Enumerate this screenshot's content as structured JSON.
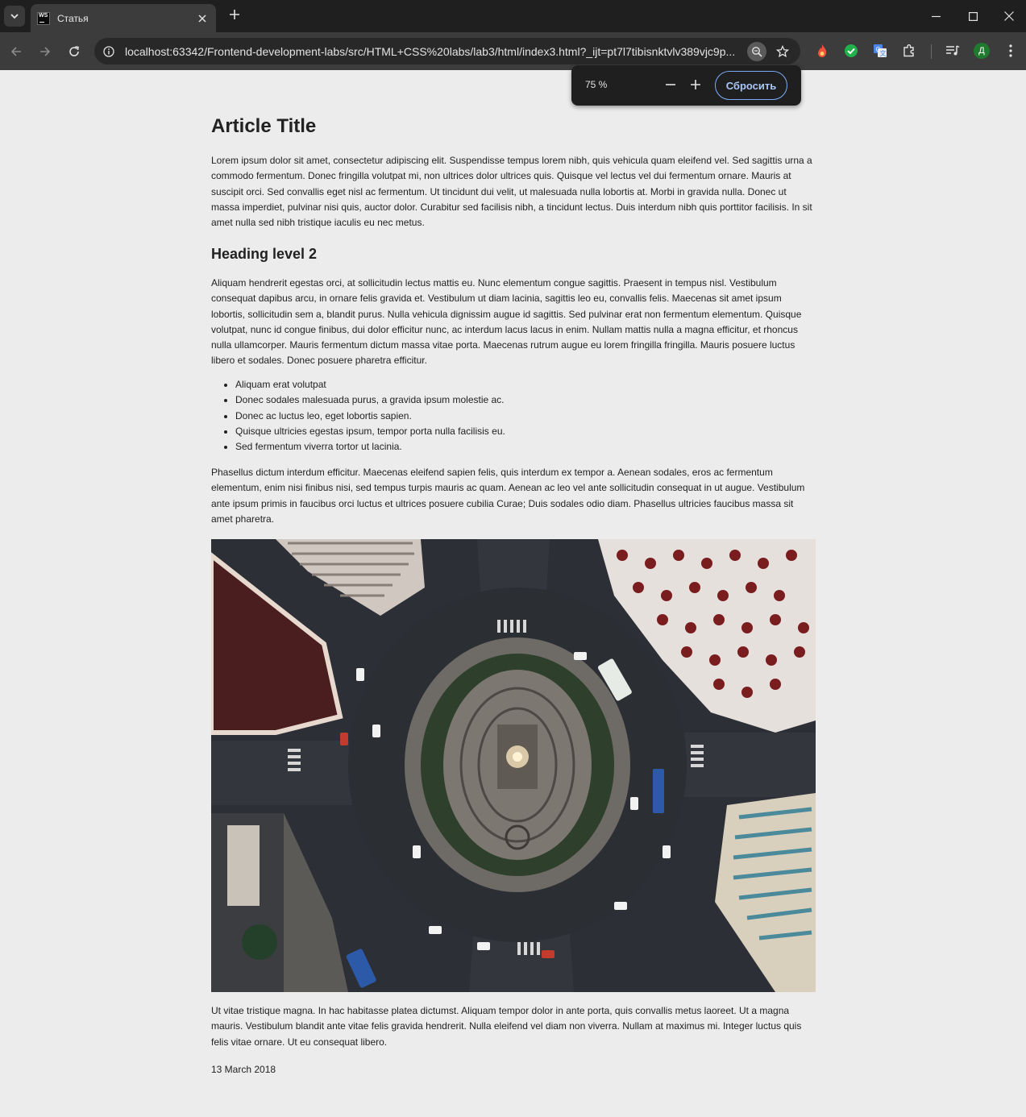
{
  "browser": {
    "tab_title": "Статья",
    "favicon_text": "WS",
    "url": "localhost:63342/Frontend-development-labs/src/HTML+CSS%20labs/lab3/html/index3.html?_ijt=pt7l7tibisnktvlv389vjc9p...",
    "avatar_letter": "Д"
  },
  "zoom_popup": {
    "level": "75 %",
    "minus": "−",
    "plus": "+",
    "reset_label": "Сбросить"
  },
  "article": {
    "title": "Article Title",
    "intro": "Lorem ipsum dolor sit amet, consectetur adipiscing elit. Suspendisse tempus lorem nibh, quis vehicula quam eleifend vel. Sed sagittis urna a commodo fermentum. Donec fringilla volutpat mi, non ultrices dolor ultrices quis. Quisque vel lectus vel dui fermentum ornare. Mauris at suscipit orci. Sed convallis eget nisl ac fermentum. Ut tincidunt dui velit, ut malesuada nulla lobortis at. Morbi in gravida nulla. Donec ut massa imperdiet, pulvinar nisi quis, auctor dolor. Curabitur sed facilisis nibh, a tincidunt lectus. Duis interdum nibh quis porttitor facilisis. In sit amet nulla sed nibh tristique iaculis eu nec metus.",
    "heading2": "Heading level 2",
    "paragraph2": "Aliquam hendrerit egestas orci, at sollicitudin lectus mattis eu. Nunc elementum congue sagittis. Praesent in tempus nisl. Vestibulum consequat dapibus arcu, in ornare felis gravida et. Vestibulum ut diam lacinia, sagittis leo eu, convallis felis. Maecenas sit amet ipsum lobortis, sollicitudin sem a, blandit purus. Nulla vehicula dignissim augue id sagittis. Sed pulvinar erat non fermentum elementum. Quisque volutpat, nunc id congue finibus, dui dolor efficitur nunc, ac interdum lacus lacus in enim. Nullam mattis nulla a magna efficitur, et rhoncus nulla ullamcorper. Mauris fermentum dictum massa vitae porta. Maecenas rutrum augue eu lorem fringilla fringilla. Mauris posuere luctus libero et sodales. Donec posuere pharetra efficitur.",
    "list": [
      "Aliquam erat volutpat",
      "Donec sodales malesuada purus, a gravida ipsum molestie ac.",
      "Donec ac luctus leo, eget lobortis sapien.",
      "Quisque ultricies egestas ipsum, tempor porta nulla facilisis eu.",
      "Sed fermentum viverra tortor ut lacinia."
    ],
    "paragraph3": "Phasellus dictum interdum efficitur. Maecenas eleifend sapien felis, quis interdum ex tempor a. Aenean sodales, eros ac fermentum elementum, enim nisi finibus nisi, sed tempus turpis mauris ac quam. Aenean ac leo vel ante sollicitudin consequat in ut augue. Vestibulum ante ipsum primis in faucibus orci luctus et ultrices posuere cubilia Curae; Duis sodales odio diam. Phasellus ultricies faucibus massa sit amet pharetra.",
    "paragraph4": "Ut vitae tristique magna. In hac habitasse platea dictumst. Aliquam tempor dolor in ante porta, quis convallis metus laoreet. Ut a magna mauris. Vestibulum blandit ante vitae felis gravida hendrerit. Nulla eleifend vel diam non viverra. Nullam at maximus mi. Integer luctus quis felis vitae ornare. Ut eu consequat libero.",
    "date": "13 March 2018"
  },
  "colors": {
    "page_bg": "#ececec",
    "tabstrip_bg": "#1f1f1f",
    "toolbar_bg": "#3c3c3c",
    "accent": "#a8c7fa"
  },
  "icons": [
    "tab-search-icon",
    "close-icon",
    "plus-icon",
    "minimize-icon",
    "maximize-icon",
    "back-arrow-icon",
    "forward-arrow-icon",
    "reload-icon",
    "site-info-icon",
    "zoom-magnifier-icon",
    "star-icon",
    "fire-extension-icon",
    "check-extension-icon",
    "translate-extension-icon",
    "puzzle-extensions-icon",
    "media-control-icon",
    "kebab-menu-icon"
  ]
}
